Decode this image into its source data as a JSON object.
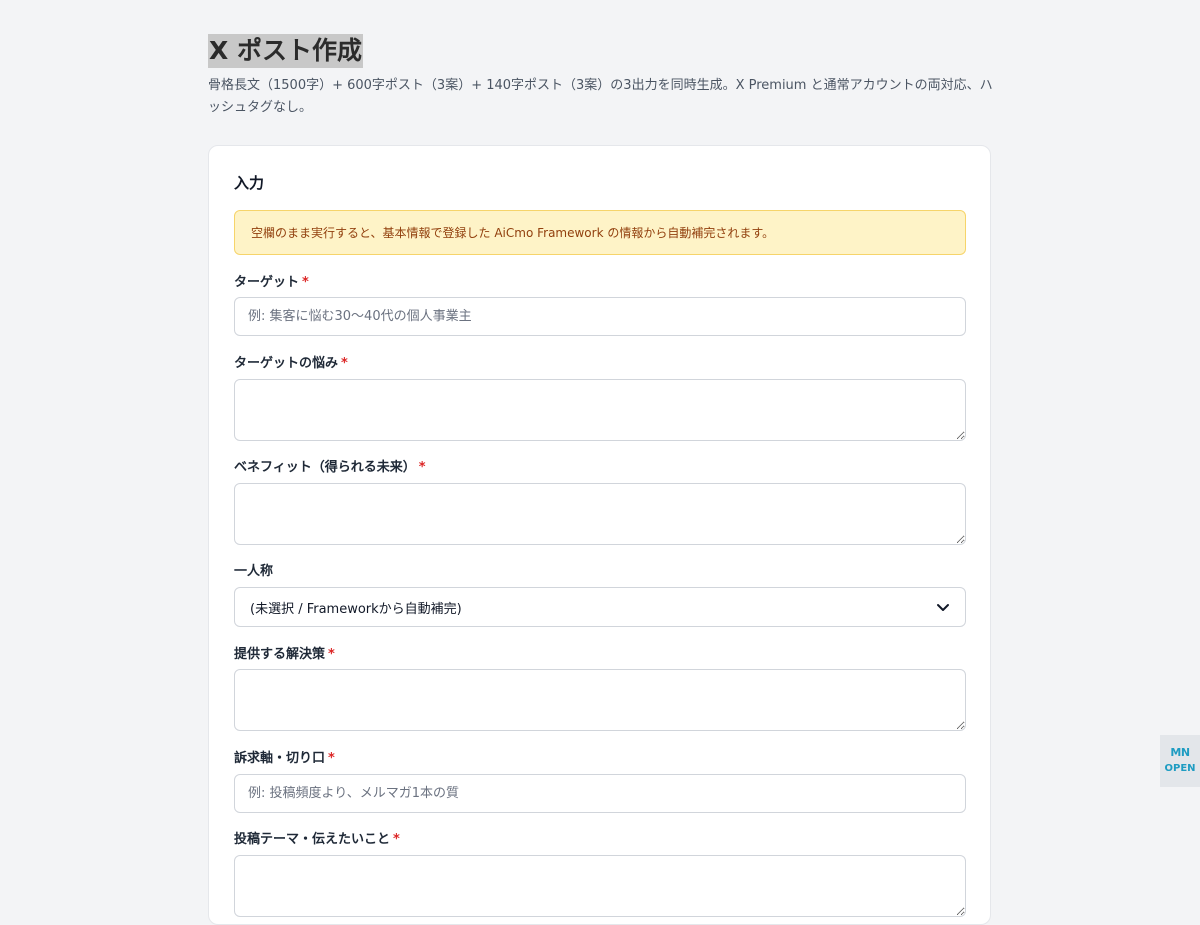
{
  "header": {
    "title": "X ポスト作成",
    "description": "骨格長文（1500字）+ 600字ポスト（3案）+ 140字ポスト（3案）の3出力を同時生成。X Premium と通常アカウントの両対応、ハッシュタグなし。"
  },
  "form": {
    "section_title": "入力",
    "notice": "空欄のまま実行すると、基本情報で登録した AiCmo Framework の情報から自動補完されます。",
    "required_mark": "*",
    "target": {
      "label": "ターゲット",
      "placeholder": "例: 集客に悩む30〜40代の個人事業主",
      "value": ""
    },
    "pain": {
      "label": "ターゲットの悩み",
      "value": ""
    },
    "benefit": {
      "label": "ベネフィット（得られる未来）",
      "value": ""
    },
    "first_person": {
      "label": "一人称",
      "selected": "(未選択 / Frameworkから自動補完)"
    },
    "solution": {
      "label": "提供する解決策",
      "value": ""
    },
    "angle": {
      "label": "訴求軸・切り口",
      "placeholder": "例: 投稿頻度より、メルマガ1本の質",
      "value": ""
    },
    "theme": {
      "label": "投稿テーマ・伝えたいこと",
      "value": ""
    }
  },
  "side_widget": {
    "logo": "MN",
    "label": "OPEN",
    "accent": "#1e9cc2"
  },
  "colors": {
    "background": "#f3f4f6",
    "notice_bg": "#fef3c7",
    "notice_text": "#92400e",
    "required": "#dc2626"
  }
}
